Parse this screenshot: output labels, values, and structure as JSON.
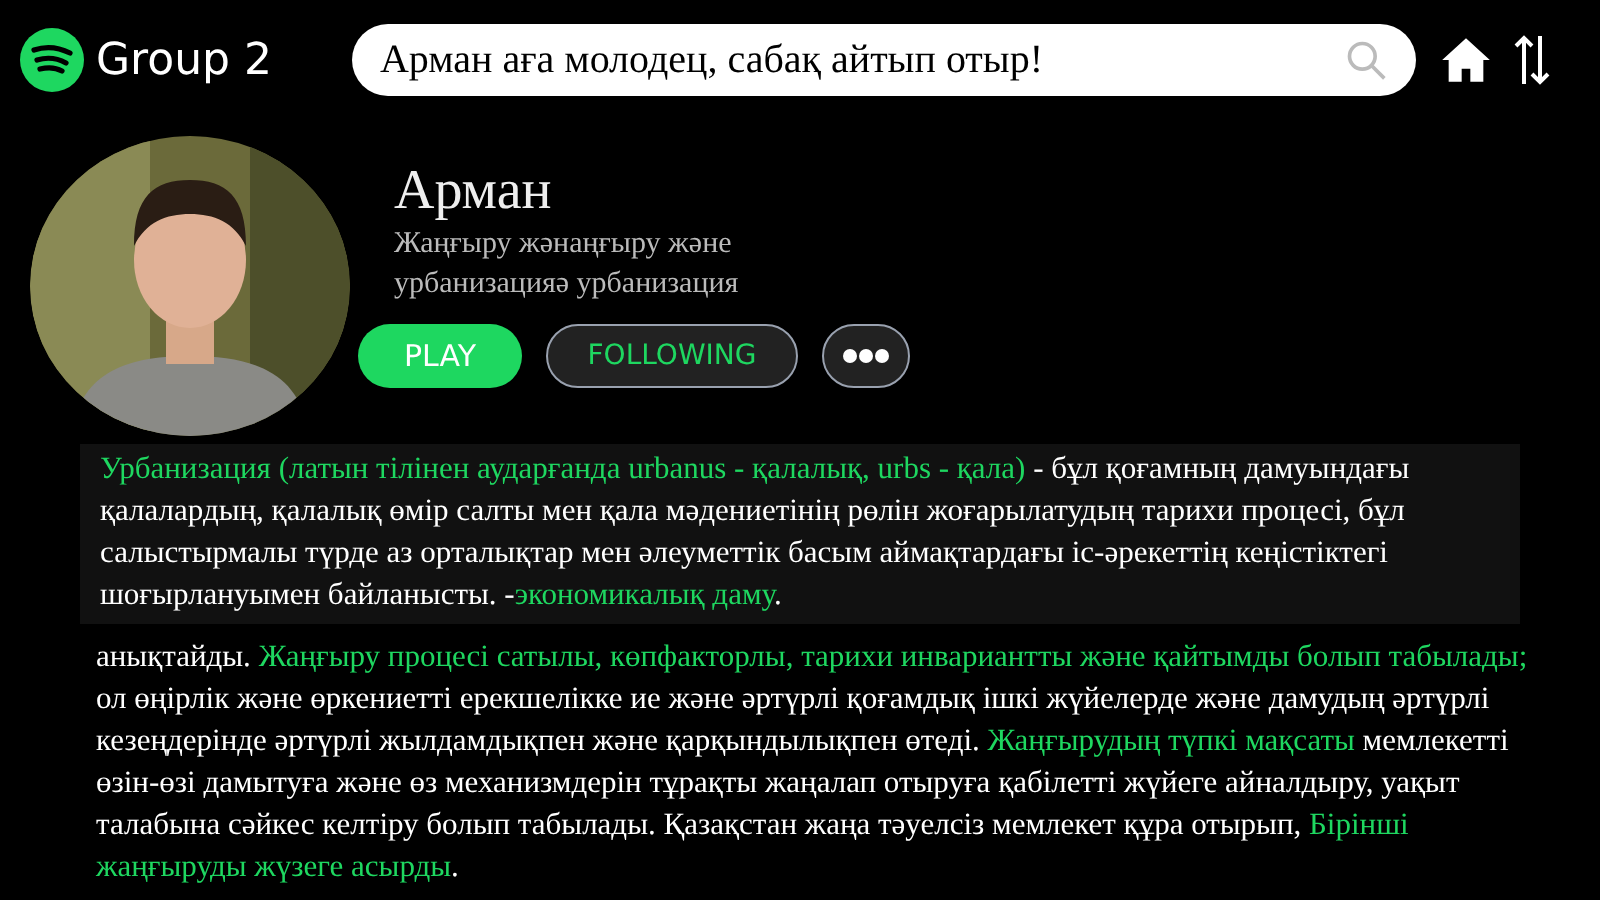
{
  "header": {
    "title": "Group 2",
    "search": {
      "value": "Арман аға молодец, сабақ айтып отыр!"
    }
  },
  "profile": {
    "name": "Арман",
    "subtitle": [
      "Жаңғыру жәнаңғыру және",
      "урбанизацияә урбанизация"
    ],
    "buttons": [
      {
        "kind": "play",
        "label": "PLAY"
      },
      {
        "kind": "following",
        "label": "FOLLOWING"
      },
      {
        "kind": "more"
      }
    ]
  },
  "paragraphs": [
    {
      "kind": "card",
      "segments": [
        {
          "text": "Урбанизация (латын тілінен аударғанда urbanus - қалалық, urbs - қала)",
          "highlight": true
        },
        {
          "text": " - бұл қоғамның дамуындағы қалалардың, қалалық өмір салты мен қала мәдениетінің рөлін жоғарылатудың тарихи процесі, бұл салыстырмалы түрде аз орталықтар мен әлеуметтік басым аймақтардағы іс-әрекеттің кеңістіктегі шоғырлануымен байланысты. -",
          "highlight": false
        },
        {
          "text": "экономикалық даму",
          "highlight": true
        },
        {
          "text": ".",
          "highlight": false
        }
      ]
    },
    {
      "kind": "plain",
      "segments": [
        {
          "text": "анықтайды. ",
          "highlight": false
        },
        {
          "text": "Жаңғыру процесі сатылы, көпфакторлы, тарихи инвариантты және қайтымды болып табылады;",
          "highlight": true
        },
        {
          "text": " ол өңірлік және өркениетті ерекшелікке ие және әртүрлі қоғамдық ішкі жүйелерде және дамудың әртүрлі кезеңдерінде әртүрлі жылдамдықпен және қарқындылықпен өтеді. ",
          "highlight": false
        },
        {
          "text": "Жаңғырудың түпкі мақсаты",
          "highlight": true
        },
        {
          "text": " мемлекетті өзін-өзі дамытуға және өз механизмдерін тұрақты жаңалап отыруға қабілетті жүйеге айналдыру, уақыт талабына сәйкес келтіру болып табылады. Қазақстан жаңа тәуелсіз мемлекет құра отырып, ",
          "highlight": false
        },
        {
          "text": "Бірінші жаңғыруды жүзеге асырды",
          "highlight": true
        },
        {
          "text": ".",
          "highlight": false
        }
      ]
    }
  ]
}
